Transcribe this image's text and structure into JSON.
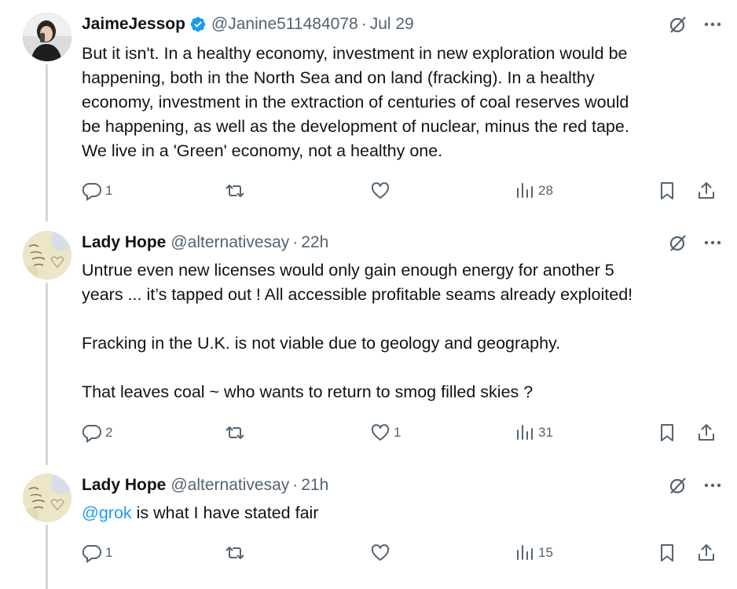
{
  "colors": {
    "accent": "#1d9bf0",
    "verified": "#1d9bf0",
    "text": "#0f1419",
    "muted": "#536471",
    "thread_line": "#cfd9de"
  },
  "tweets": [
    {
      "name": "JaimeJessop",
      "verified": true,
      "handle": "@Janine511484078",
      "time": "Jul 29",
      "avatar": "user-photo",
      "lines": [
        "But it isn't. In a healthy economy, investment in new exploration would be",
        "happening, both in the North Sea and on land (fracking). In a healthy",
        "economy, investment in the extraction of centuries of coal reserves would",
        "be happening, as well as the development of nuclear, minus the red tape.",
        "We live in a 'Green' economy, not a healthy one."
      ],
      "replies": "1",
      "reposts": "",
      "likes": "",
      "views": "28"
    },
    {
      "name": "Lady Hope",
      "verified": false,
      "handle": "@alternativesay",
      "time": "22h",
      "avatar": "handwritten-note-avatar",
      "lines": [
        "Untrue even new licenses would only gain enough energy for another 5",
        "years ... it’s tapped out ! All accessible profitable seams already exploited!",
        "",
        "Fracking in the U.K. is not viable due to geology and geography.",
        "",
        "That leaves coal ~ who wants to return to smog filled skies ?"
      ],
      "replies": "2",
      "reposts": "",
      "likes": "1",
      "views": "31"
    },
    {
      "name": "Lady Hope",
      "verified": false,
      "handle": "@alternativesay",
      "time": "21h",
      "avatar": "handwritten-note-avatar",
      "mention": "@grok",
      "text_after_mention": " is what I have stated fair",
      "replies": "1",
      "reposts": "",
      "likes": "",
      "views": "15"
    }
  ]
}
